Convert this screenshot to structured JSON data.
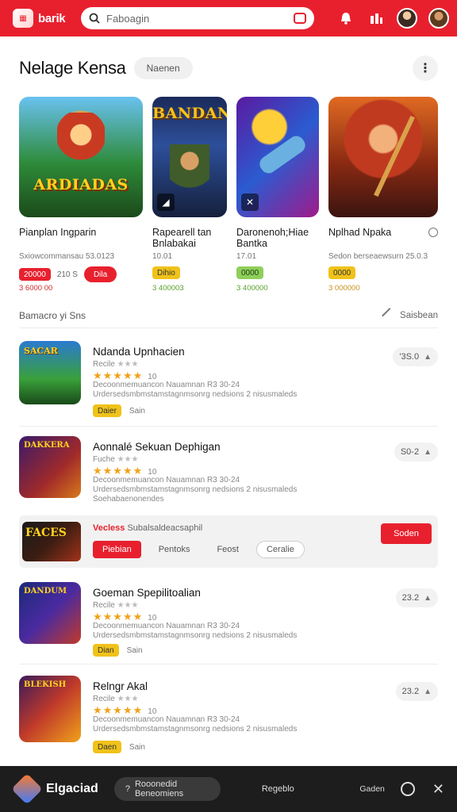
{
  "topbar": {
    "logo_text": "barik",
    "search_placeholder": "Faboagin",
    "icons": [
      "notification-icon",
      "stats-icon"
    ]
  },
  "header": {
    "title": "Nelage Kensa",
    "chip": "Naenen"
  },
  "featured": [
    {
      "art_title": "ARDIADAS",
      "name": "Pianplan Ingparin",
      "meta": "Sxiowcommansau 53.0123",
      "badges": [
        "20000",
        "210 S",
        "Dila"
      ],
      "small": "3 6000 00"
    },
    {
      "art_title": "BANDAN",
      "art_sub": "BANDAN",
      "name_lines": [
        "Rapearell tan",
        "Bnlabakai"
      ],
      "meta": "10.01",
      "badges": [
        "Dihio"
      ],
      "small": "3 400003"
    },
    {
      "name_lines": [
        "Daronenoh;Hiae",
        "Bantka"
      ],
      "meta": "17.01",
      "badges": [
        "0000"
      ],
      "small": "3 400000"
    },
    {
      "name": "Nplhad Npaka",
      "meta": "Sedon berseaewsurn 25.0.3",
      "badges": [
        "0000"
      ],
      "small": "3 000000"
    }
  ],
  "section": {
    "title": "Bamacro yi Sns",
    "action": "Saisbean"
  },
  "list": [
    {
      "title": "Ndanda Upnhacien",
      "sub": "Recile",
      "stars": "★★★★★",
      "rating": "10",
      "desc": [
        "Decoonmemuancon Nauamnan R3 30-24",
        "Urdersedsmbmstamstagnmsonrg nedsions 2 nisusmaleds"
      ],
      "button": "Daier",
      "extra": "Sain",
      "price": "'3S.0"
    },
    {
      "title": "Aonnalé Sekuan Dephigan",
      "sub": "Fuche",
      "stars": "★★★★★",
      "rating": "10",
      "desc": [
        "Decoonmemuancon Nauamnan R3 30-24",
        "Urdersedsmbmstamstagnmsonrg nedsions 2 nisusmaleds",
        "Soehabaenonendes"
      ],
      "price": "S0-2"
    },
    {
      "title": "Goeman Spepilitoalian",
      "sub": "Recile",
      "stars": "★★★★★",
      "rating": "10",
      "desc": [
        "Decoonmemuancon Nauamnan R3 30-24",
        "Urdersedsmbmstamstagnmsonrg nedsions 2 nisusmaleds"
      ],
      "button": "Dian",
      "extra": "Sain",
      "price": "23.2"
    },
    {
      "title": "Relngr Akal",
      "sub": "Recile",
      "stars": "★★★★★",
      "rating": "10",
      "desc": [
        "Decoonmemuancon Nauamnan R3 30-24",
        "Urdersedsmbmstamstagnmsonrg nedsions 2 nisusmaleds"
      ],
      "button": "Daen",
      "extra": "Sain",
      "price": "23.2"
    }
  ],
  "promo": {
    "thumb_text": "FACES",
    "title_red": "Vecless",
    "title_rest": "Subalsaldeacsaphil",
    "buttons": [
      "Piebian",
      "Pentoks",
      "Feost",
      "Ceralie"
    ],
    "cta": "Soden"
  },
  "bottombar": {
    "brand": "Elgaciad",
    "pill": "Rooonedid Beneomiens",
    "link": "Regeblo",
    "link2": "Gaden"
  },
  "colors": {
    "accent": "#e8202e",
    "star": "#f0a21a",
    "dark": "#1d1d1d"
  }
}
